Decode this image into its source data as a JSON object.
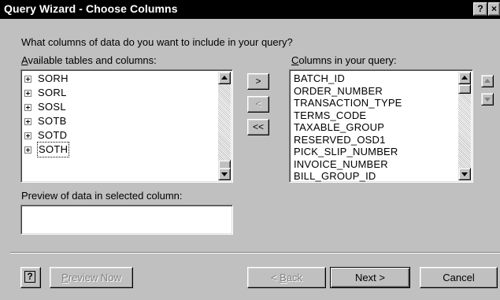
{
  "window": {
    "title": "Query Wizard - Choose Columns",
    "help_glyph": "?",
    "close_glyph": "×"
  },
  "prompt": "What columns of data do you want to include in your query?",
  "available": {
    "label_accel": "A",
    "label_rest": "vailable tables and columns:",
    "items": [
      {
        "name": "SORH"
      },
      {
        "name": "SORL"
      },
      {
        "name": "SOSL"
      },
      {
        "name": "SOTB"
      },
      {
        "name": "SOTD"
      },
      {
        "name": "SOTH",
        "focused": true
      }
    ]
  },
  "move_buttons": {
    "add": ">",
    "remove": "<",
    "remove_all": "<<"
  },
  "columns": {
    "label_accel": "C",
    "label_rest": "olumns in your query:",
    "items": [
      "BATCH_ID",
      "ORDER_NUMBER",
      "TRANSACTION_TYPE",
      "TERMS_CODE",
      "TAXABLE_GROUP",
      "RESERVED_OSD1",
      "PICK_SLIP_NUMBER",
      "INVOICE_NUMBER",
      "BILL_GROUP_ID"
    ]
  },
  "preview": {
    "label": "Preview of data in selected column:",
    "value": ""
  },
  "footer": {
    "help_glyph": "?",
    "preview_now_accel": "P",
    "preview_now_rest": "review Now",
    "back_prefix": "< ",
    "back_accel": "B",
    "back_rest": "ack",
    "next": "Next >",
    "cancel": "Cancel"
  },
  "colors": {
    "face": "#c0c0c0",
    "titlebar": "#000000",
    "window": "#ffffff",
    "disabled_text": "#808080"
  }
}
